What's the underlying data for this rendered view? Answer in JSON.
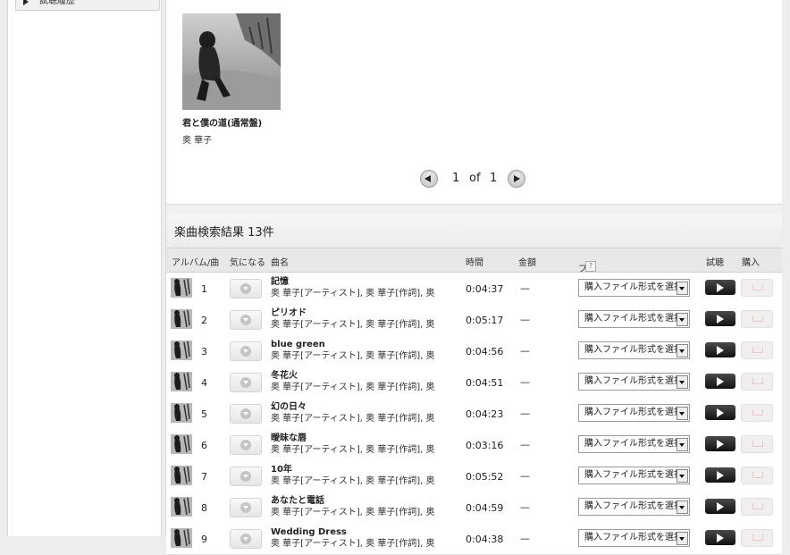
{
  "sidebar": {
    "item_label": "試聴履歴"
  },
  "album": {
    "title": "君と僕の道(通常盤)",
    "artist": "奥 華子"
  },
  "pager": {
    "current": "1",
    "of": "of",
    "total": "1"
  },
  "results": {
    "title": "楽曲検索結果 13件",
    "columns": {
      "album_song": "アルバム/曲",
      "fav": "気になる",
      "name": "曲名",
      "time": "時間",
      "price": "金額",
      "format": "ファイル形式",
      "format_help": "?",
      "preview": "試聴",
      "buy": "購入"
    },
    "rows": [
      {
        "num": "1",
        "title": "記憶",
        "credit": "奥 華子[アーティスト], 奥 華子[作詞], 奥",
        "time": "0:04:37",
        "price": "—",
        "format": "購入ファイル形式を選択"
      },
      {
        "num": "2",
        "title": "ピリオド",
        "credit": "奥 華子[アーティスト], 奥 華子[作詞], 奥",
        "time": "0:05:17",
        "price": "—",
        "format": "購入ファイル形式を選択"
      },
      {
        "num": "3",
        "title": "blue green",
        "credit": "奥 華子[アーティスト], 奥 華子[作詞], 奥",
        "time": "0:04:56",
        "price": "—",
        "format": "購入ファイル形式を選択"
      },
      {
        "num": "4",
        "title": "冬花火",
        "credit": "奥 華子[アーティスト], 奥 華子[作詞], 奥",
        "time": "0:04:51",
        "price": "—",
        "format": "購入ファイル形式を選択"
      },
      {
        "num": "5",
        "title": "幻の日々",
        "credit": "奥 華子[アーティスト], 奥 華子[作詞], 奥",
        "time": "0:04:23",
        "price": "—",
        "format": "購入ファイル形式を選択"
      },
      {
        "num": "6",
        "title": "曖昧な唇",
        "credit": "奥 華子[アーティスト], 奥 華子[作詞], 奥",
        "time": "0:03:16",
        "price": "—",
        "format": "購入ファイル形式を選択"
      },
      {
        "num": "7",
        "title": "10年",
        "credit": "奥 華子[アーティスト], 奥 華子[作詞], 奥",
        "time": "0:05:52",
        "price": "—",
        "format": "購入ファイル形式を選択"
      },
      {
        "num": "8",
        "title": "あなたと電話",
        "credit": "奥 華子[アーティスト], 奥 華子[作詞], 奥",
        "time": "0:04:59",
        "price": "—",
        "format": "購入ファイル形式を選択"
      },
      {
        "num": "9",
        "title": "Wedding Dress",
        "credit": "奥 華子[アーティスト], 奥 華子[作詞], 奥",
        "time": "0:04:38",
        "price": "—",
        "format": "購入ファイル形式を選択"
      }
    ]
  }
}
